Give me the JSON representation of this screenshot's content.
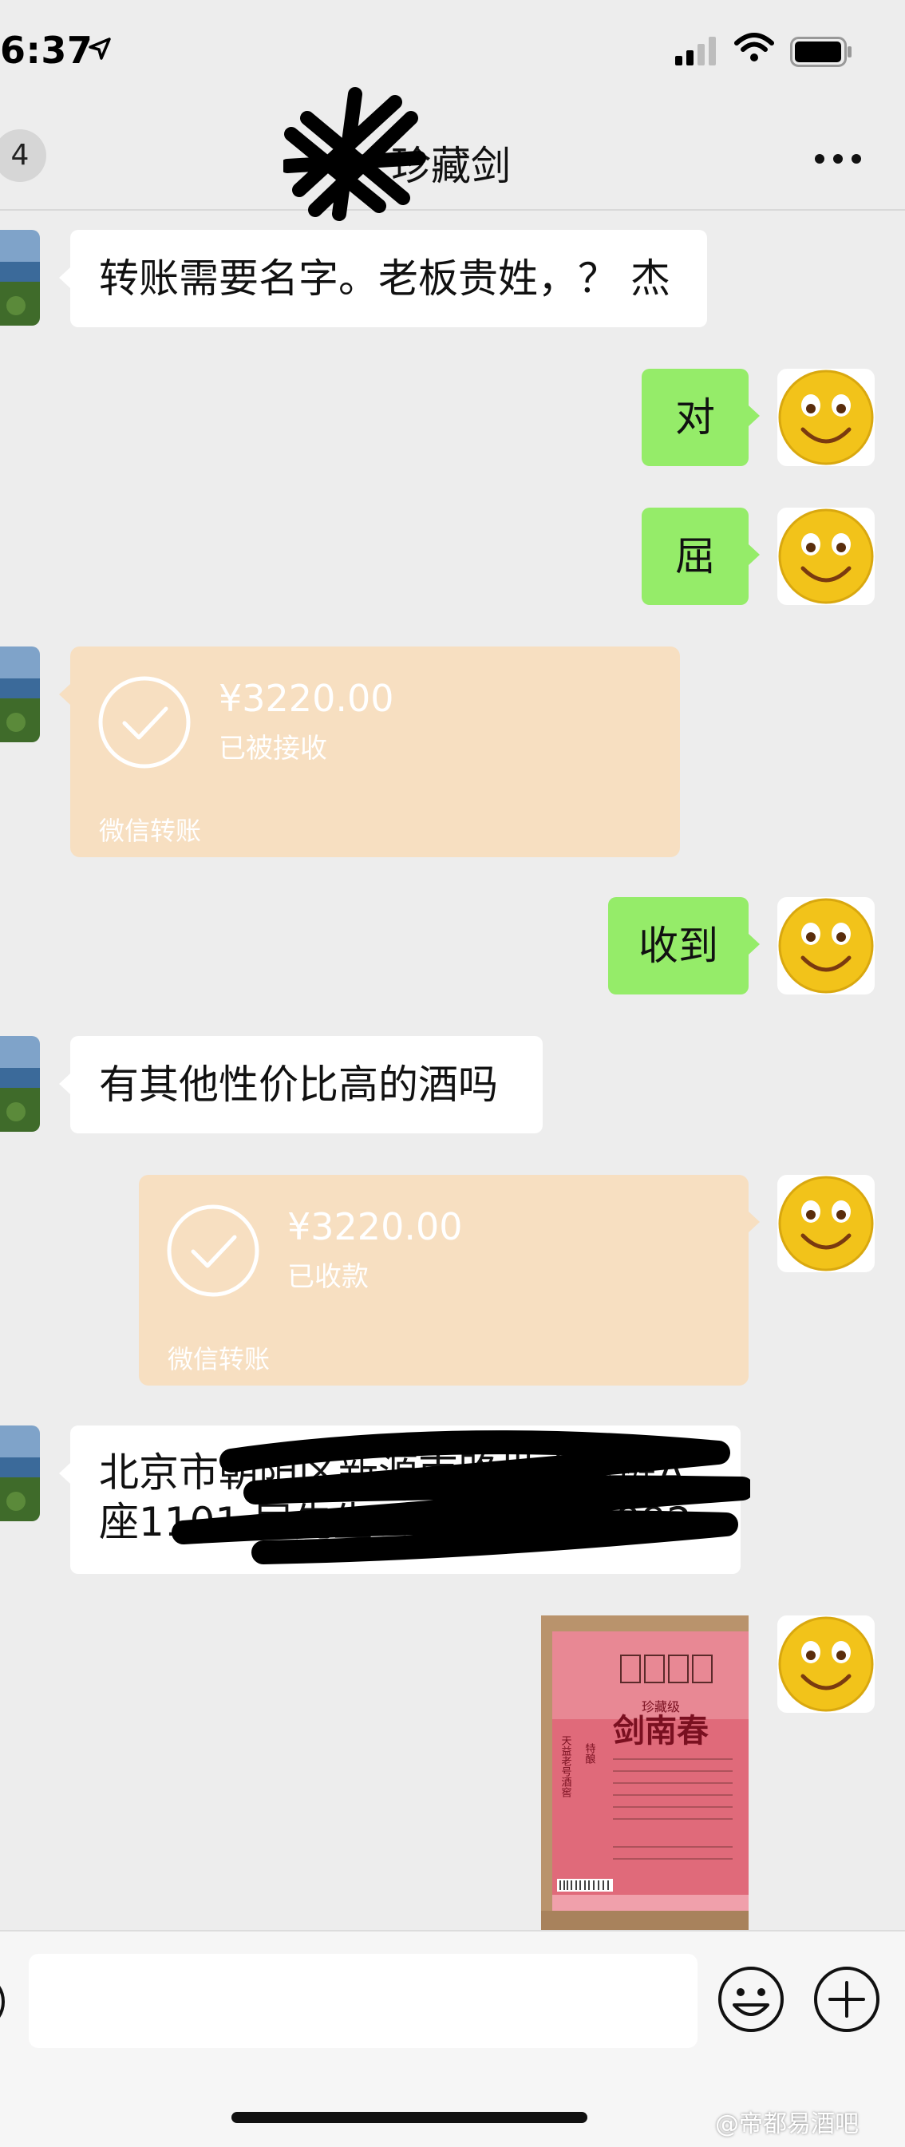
{
  "status_bar": {
    "time": "6:37"
  },
  "nav": {
    "back_count": "4",
    "title": "珍藏剑"
  },
  "messages": {
    "m1": "转账需要名字。老板贵姓，？ 杰",
    "m2": "对",
    "m3": "屈",
    "m5": "收到",
    "m6": "有其他性价比高的酒吗",
    "m8_line1": "北京市朝阳区新源南路世方豪庭A",
    "m8_line2": "座1101 屈先生：13466394992"
  },
  "transfers": {
    "t1": {
      "amount": "¥3220.00",
      "status": "已被接收",
      "footer": "微信转账"
    },
    "t2": {
      "amount": "¥3220.00",
      "status": "已收款",
      "footer": "微信转账"
    }
  },
  "image_message": {
    "brand_top": "珍藏级",
    "brand_name": "剑南春",
    "side_label": "天益老号酒窖",
    "special": "特酿"
  },
  "watermark": "@帝都易酒吧",
  "colors": {
    "green_bubble": "#95ec69",
    "transfer_bg": "#f7dfc1",
    "background": "#ededed"
  }
}
